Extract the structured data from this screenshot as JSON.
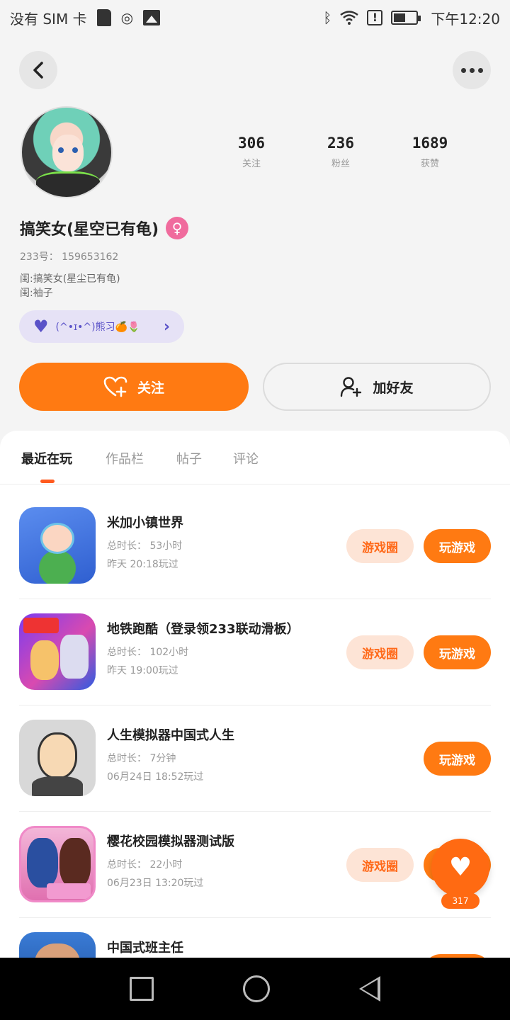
{
  "status_bar": {
    "carrier": "没有 SIM 卡",
    "time": "下午12:20",
    "icons": [
      "sim-card-icon",
      "location-icon",
      "image-icon",
      "bluetooth-icon",
      "wifi-icon",
      "alert-icon",
      "battery-icon"
    ]
  },
  "profile": {
    "stats": [
      {
        "value": "306",
        "label": "关注"
      },
      {
        "value": "236",
        "label": "粉丝"
      },
      {
        "value": "1689",
        "label": "获赞"
      }
    ],
    "name": "搞笑女(星空已有龟)",
    "gender_symbol": "♀",
    "id_text": "233号： 159653162",
    "bio_lines": [
      "闺:搞笑女(星尘已有龟)",
      "闺:袖子"
    ],
    "tag_text": "(^•ɪ•^)熊习🍊🌷",
    "follow_label": "关注",
    "add_friend_label": "加好友"
  },
  "tabs": [
    "最近在玩",
    "作品栏",
    "帖子",
    "评论"
  ],
  "games": [
    {
      "name": "米加小镇世界",
      "duration": "总时长： 53小时",
      "last_played": "昨天 20:18玩过",
      "has_circle": true
    },
    {
      "name": "地铁跑酷（登录领233联动滑板）",
      "duration": "总时长： 102小时",
      "last_played": "昨天 19:00玩过",
      "has_circle": true
    },
    {
      "name": "人生模拟器中国式人生",
      "duration": "总时长： 7分钟",
      "last_played": "06月24日 18:52玩过",
      "has_circle": false
    },
    {
      "name": "樱花校园模拟器测试版",
      "duration": "总时长： 22小时",
      "last_played": "06月23日 13:20玩过",
      "has_circle": true
    },
    {
      "name": "中国式班主任",
      "duration": "",
      "last_played": "",
      "has_circle": false
    }
  ],
  "buttons": {
    "game_circle": "游戏圈",
    "play_game": "玩游戏"
  },
  "fab": {
    "count": "317"
  },
  "colors": {
    "accent": "#ff7a12",
    "tag_bg": "#e6e2f6",
    "tag_text": "#5a52c8",
    "circle_bg": "#fde4d6"
  }
}
